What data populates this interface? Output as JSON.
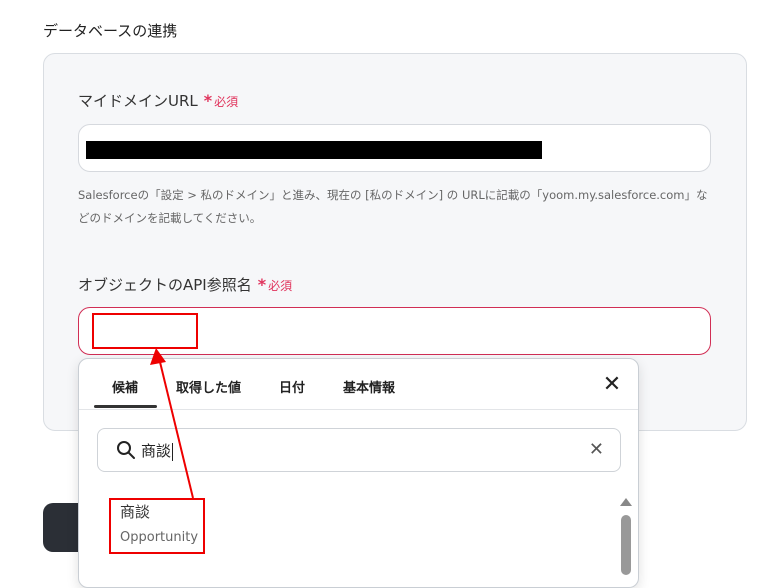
{
  "section_title": "データベースの連携",
  "domain_field": {
    "label": "マイドメインURL",
    "required_mark": "*",
    "required_text": "必須",
    "value": "",
    "hint": "Salesforceの「設定 > 私のドメイン」と進み、現在の [私のドメイン] の URLに記載の「yoom.my.salesforce.com」などのドメインを記載してください。"
  },
  "object_field": {
    "label": "オブジェクトのAPI参照名",
    "required_mark": "*",
    "required_text": "必須",
    "value": ""
  },
  "dropdown": {
    "tabs": [
      "候補",
      "取得した値",
      "日付",
      "基本情報"
    ],
    "active_tab": "候補",
    "close_icon": "close-icon",
    "search_value": "商談",
    "results": [
      {
        "name": "商談",
        "api_name": "Opportunity"
      }
    ]
  },
  "colors": {
    "required": "#e0335c",
    "error_border": "#d12e55",
    "annotation": "#ee0000",
    "button_dark": "#2b2f36"
  }
}
